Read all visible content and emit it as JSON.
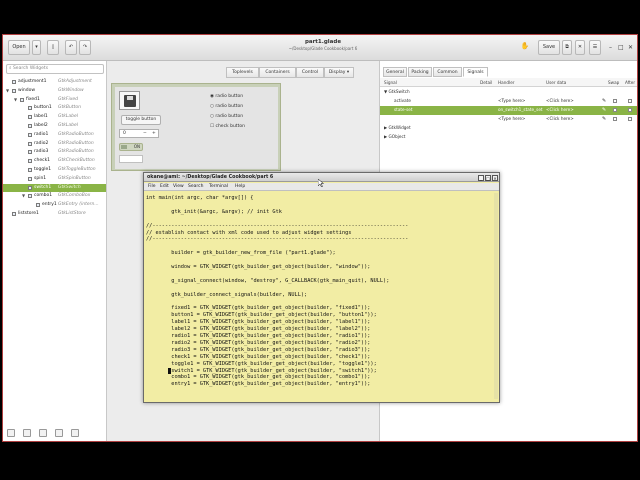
{
  "header": {
    "open_label": "Open",
    "title": "part1.glade",
    "subtitle": "~/Desktop/Glade Cookbook/part 6",
    "save_label": "Save"
  },
  "left_panel": {
    "search_placeholder": "Search Widgets",
    "tree": [
      {
        "name": "adjustment1",
        "type": "GtkAdjustment",
        "depth": 0,
        "arrow": ""
      },
      {
        "name": "window",
        "type": "GtkWindow",
        "depth": 0,
        "arrow": "▼"
      },
      {
        "name": "fixed1",
        "type": "GtkFixed",
        "depth": 1,
        "arrow": "▼"
      },
      {
        "name": "button1",
        "type": "GtkButton",
        "depth": 2,
        "arrow": ""
      },
      {
        "name": "label1",
        "type": "GtkLabel",
        "depth": 2,
        "arrow": ""
      },
      {
        "name": "label2",
        "type": "GtkLabel",
        "depth": 2,
        "arrow": ""
      },
      {
        "name": "radio1",
        "type": "GtkRadioButton",
        "depth": 2,
        "arrow": ""
      },
      {
        "name": "radio2",
        "type": "GtkRadioButton",
        "depth": 2,
        "arrow": ""
      },
      {
        "name": "radio3",
        "type": "GtkRadioButton",
        "depth": 2,
        "arrow": ""
      },
      {
        "name": "check1",
        "type": "GtkCheckButton",
        "depth": 2,
        "arrow": ""
      },
      {
        "name": "toggle1",
        "type": "GtkToggleButton",
        "depth": 2,
        "arrow": ""
      },
      {
        "name": "spin1",
        "type": "GtkSpinButton",
        "depth": 2,
        "arrow": ""
      },
      {
        "name": "switch1",
        "type": "GtkSwitch",
        "depth": 2,
        "arrow": "",
        "selected": true
      },
      {
        "name": "combo1",
        "type": "GtkComboBox",
        "depth": 2,
        "arrow": "▼"
      },
      {
        "name": "entry1",
        "type": "GtkEntry (intern...",
        "depth": 3,
        "arrow": ""
      },
      {
        "name": "liststore1",
        "type": "GtkListStore",
        "depth": 0,
        "arrow": ""
      }
    ]
  },
  "center": {
    "tabs": [
      "Toplevels",
      "Containers",
      "Control",
      "Display"
    ],
    "preview": {
      "toggle_label": "toggle button",
      "radio_labels": [
        "radio button",
        "radio button",
        "radio button"
      ],
      "check_label": "check button",
      "spin_value": "0",
      "switch_label": "ON"
    }
  },
  "right_panel": {
    "tabs": [
      "General",
      "Packing",
      "Common",
      "Signals"
    ],
    "active_tab": "Signals",
    "columns": [
      "Signal",
      "Detail",
      "Handler",
      "User data",
      "Swap",
      "After"
    ],
    "rows": [
      {
        "signal": "▼ GtkSwitch",
        "handler": "",
        "user_data": "",
        "level": 0
      },
      {
        "signal": "activate",
        "handler": "<Type here>",
        "user_data": "<Click here>",
        "level": 1
      },
      {
        "signal": "state-set",
        "handler": "on_switch1_state_set",
        "user_data": "<Click here>",
        "level": 1,
        "selected": true
      },
      {
        "signal": "",
        "handler": "<Type here>",
        "user_data": "<Click here>",
        "level": 1
      },
      {
        "signal": "▶ GtkWidget",
        "handler": "",
        "user_data": "",
        "level": 0
      },
      {
        "signal": "▶ GObject",
        "handler": "",
        "user_data": "",
        "level": 0
      }
    ]
  },
  "terminal": {
    "title": "okane@ami: ~/Desktop/Glade Cookbook/part 6",
    "menu": [
      "File",
      "Edit",
      "View",
      "Search",
      "Terminal",
      "Help"
    ],
    "lines": [
      "int main(int argc, char *argv[]) {",
      "",
      "        gtk_init(&argc, &argv); // init Gtk",
      "",
      "//---------------------------------------------------------------------------------",
      "// establish contact with xml code used to adjust widget settings",
      "//---------------------------------------------------------------------------------",
      "",
      "        builder = gtk_builder_new_from_file (\"part1.glade\");",
      "",
      "        window = GTK_WIDGET(gtk_builder_get_object(builder, \"window\"));",
      "",
      "        g_signal_connect(window, \"destroy\", G_CALLBACK(gtk_main_quit), NULL);",
      "",
      "        gtk_builder_connect_signals(builder, NULL);",
      "",
      "        fixed1 = GTK_WIDGET(gtk_builder_get_object(builder, \"fixed1\"));",
      "        button1 = GTK_WIDGET(gtk_builder_get_object(builder, \"button1\"));",
      "        label1 = GTK_WIDGET(gtk_builder_get_object(builder, \"label1\"));",
      "        label2 = GTK_WIDGET(gtk_builder_get_object(builder, \"label2\"));",
      "        radio1 = GTK_WIDGET(gtk_builder_get_object(builder, \"radio1\"));",
      "        radio2 = GTK_WIDGET(gtk_builder_get_object(builder, \"radio2\"));",
      "        radio3 = GTK_WIDGET(gtk_builder_get_object(builder, \"radio3\"));",
      "        check1 = GTK_WIDGET(gtk_builder_get_object(builder, \"check1\"));",
      "        toggle1 = GTK_WIDGET(gtk_builder_get_object(builder, \"toggle1\"));",
      "        switch1 = GTK_WIDGET(gtk_builder_get_object(builder, \"switch1\"));",
      "        combo1 = GTK_WIDGET(gtk_builder_get_object(builder, \"combo1\"));",
      "        entry1 = GTK_WIDGET(gtk_builder_get_object(builder, \"entry1\"));"
    ]
  },
  "colors": {
    "selection": "#8ab446",
    "terminal_bg": "#f2eda4"
  }
}
